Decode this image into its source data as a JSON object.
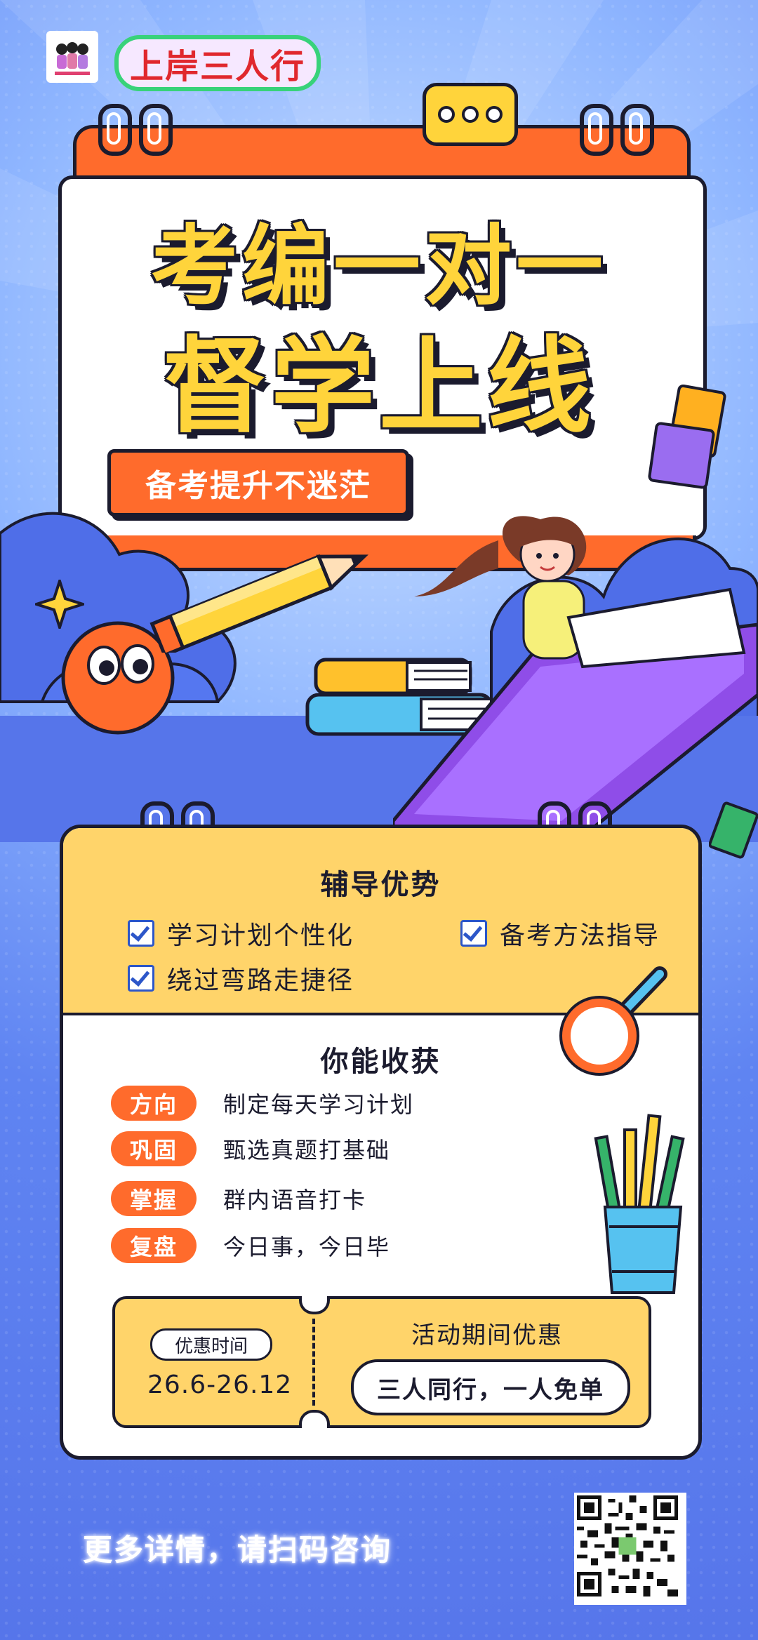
{
  "brand": {
    "name": "上岸三人行"
  },
  "hero": {
    "line1": "考编一对一",
    "line2": "督学上线",
    "tagline": "备考提升不迷茫"
  },
  "advantages": {
    "title": "辅导优势",
    "items": [
      "学习计划个性化",
      "备考方法指导",
      "绕过弯路走捷径"
    ]
  },
  "gains": {
    "title": "你能收获",
    "rows": [
      {
        "tag": "方向",
        "text": "制定每天学习计划"
      },
      {
        "tag": "巩固",
        "text": "甄选真题打基础"
      },
      {
        "tag": "掌握",
        "text": "群内语音打卡"
      },
      {
        "tag": "复盘",
        "text": "今日事，今日毕"
      }
    ]
  },
  "promo": {
    "label": "优惠时间",
    "dates": "26.6-26.12",
    "heading": "活动期间优惠",
    "offer": "三人同行，一人免单"
  },
  "footer": {
    "cta": "更多详情，请扫码咨询"
  },
  "colors": {
    "orange": "#ff6b2c",
    "yellow": "#ffd43b",
    "blue": "#5675ea",
    "ink": "#1b1b2e"
  }
}
